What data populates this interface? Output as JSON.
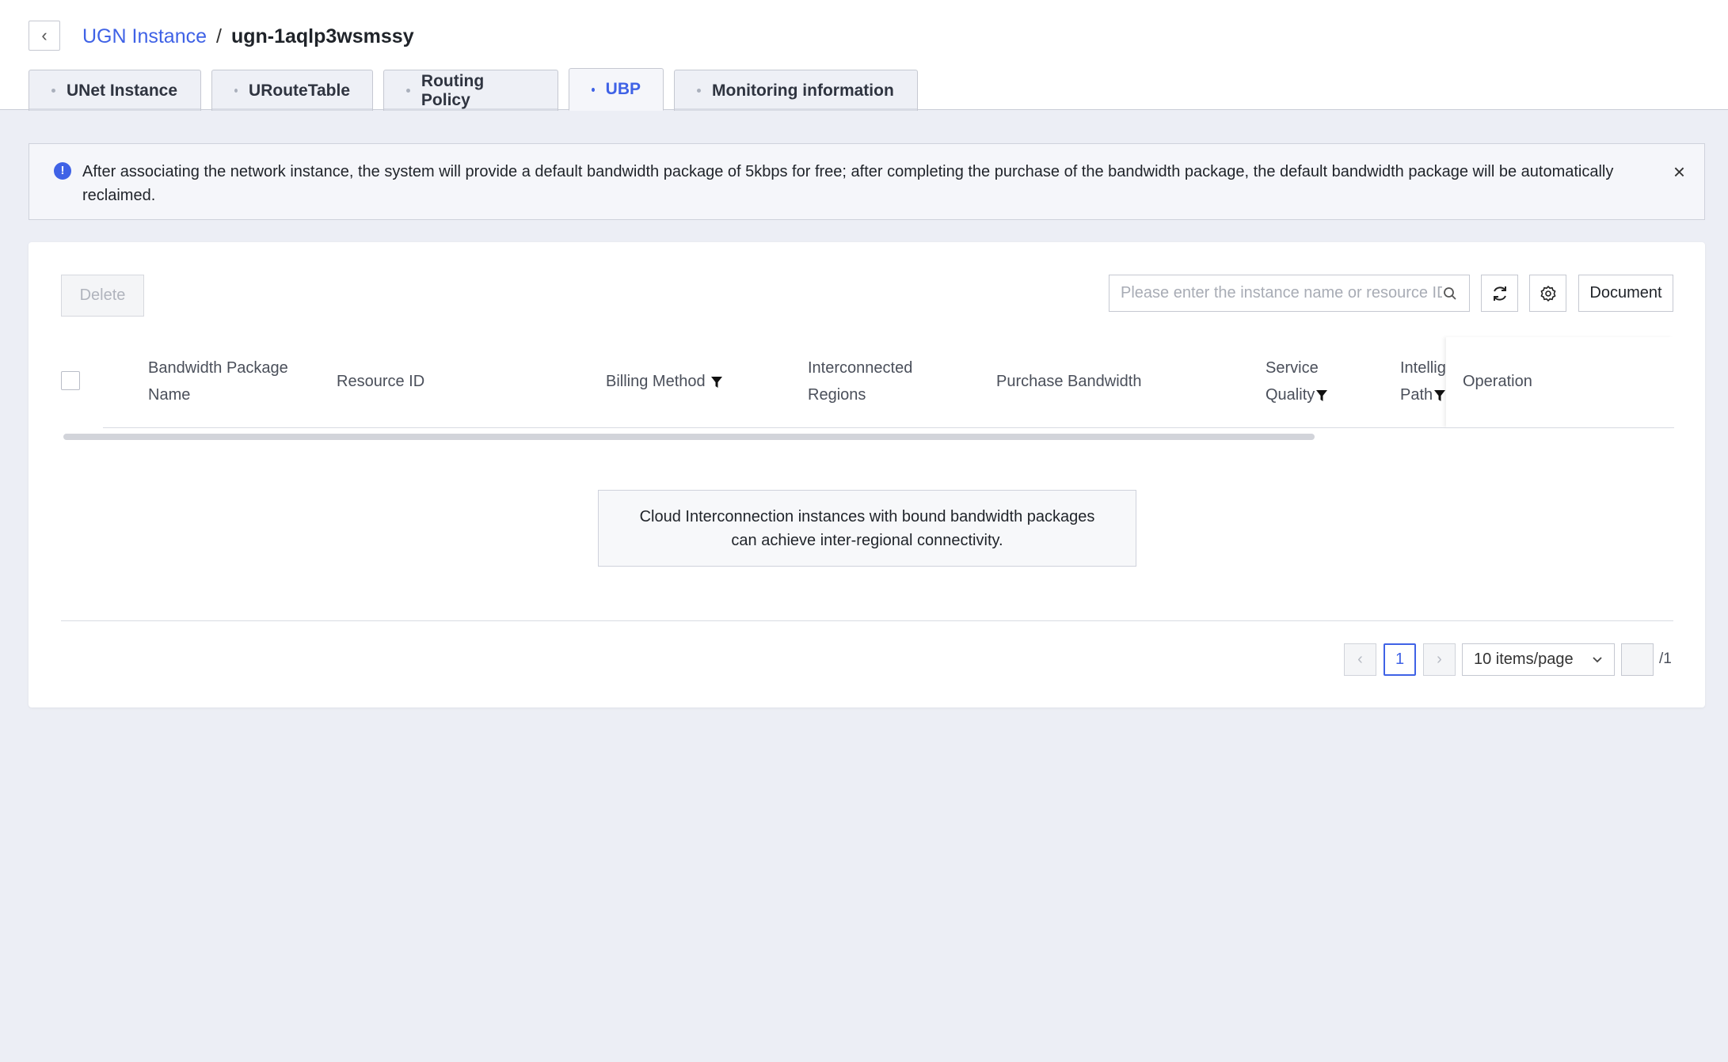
{
  "header": {
    "back_icon": "chevron-left-icon",
    "breadcrumb_parent": "UGN Instance",
    "breadcrumb_separator": "/",
    "breadcrumb_current": "ugn-1aqlp3wsmssy"
  },
  "tabs": [
    {
      "label": "UNet Instance",
      "active": false
    },
    {
      "label": "URouteTable",
      "active": false
    },
    {
      "label": "Routing Policy",
      "active": false
    },
    {
      "label": "UBP",
      "active": true
    },
    {
      "label": "Monitoring information",
      "active": false
    }
  ],
  "notice": {
    "icon": "info-icon",
    "text": "After associating the network instance, the system will provide a default bandwidth package of 5kbps for free; after completing the purchase of the bandwidth package, the default bandwidth package will be automatically reclaimed.",
    "close_icon": "close-icon"
  },
  "toolbar": {
    "delete_label": "Delete",
    "search_placeholder": "Please enter the instance name or resource ID",
    "refresh_icon": "refresh-icon",
    "settings_icon": "gear-icon",
    "document_label": "Document"
  },
  "table": {
    "columns": [
      {
        "line1": "Bandwidth Package",
        "line2": "Name",
        "filter": false
      },
      {
        "line1": "Resource ID",
        "line2": "",
        "filter": false
      },
      {
        "line1": "Billing Method",
        "line2": "",
        "filter": true
      },
      {
        "line1": "Interconnected",
        "line2": "Regions",
        "filter": false
      },
      {
        "line1": "Purchase Bandwidth",
        "line2": "",
        "filter": false
      },
      {
        "line1": "Service",
        "line2": "Quality",
        "filter": true
      },
      {
        "line1": "Intellig",
        "line2": "Path",
        "filter": true
      },
      {
        "line1": "Operation",
        "line2": "",
        "filter": false
      }
    ],
    "empty_text_line1": "Cloud Interconnection instances with bound bandwidth packages",
    "empty_text_line2": "can achieve inter-regional connectivity."
  },
  "pagination": {
    "prev": "‹",
    "current_page": "1",
    "next": "›",
    "page_size": "10 items/page",
    "total_pages": "/1"
  },
  "colors": {
    "accent": "#3f62e6",
    "background": "#eceef5"
  }
}
